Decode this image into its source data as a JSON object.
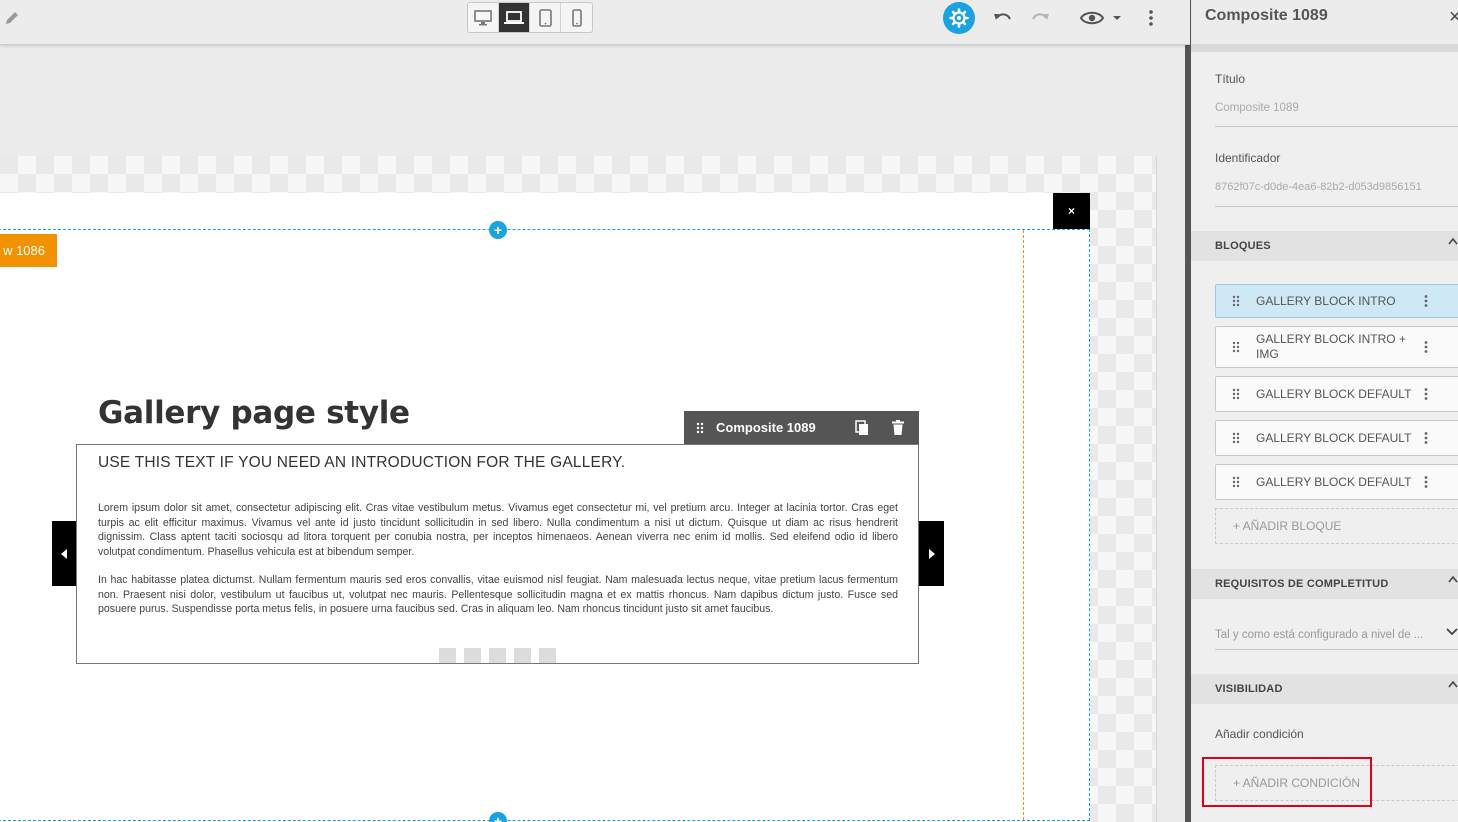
{
  "toolbar": {
    "devices": [
      "desktop-icon",
      "laptop-icon",
      "tablet-icon",
      "mobile-icon"
    ],
    "active_device": "laptop-icon",
    "accent_color": "#1aa3e0"
  },
  "canvas": {
    "close_label": "×",
    "row_label": "w 1086",
    "plus": "+",
    "gallery_title": "Gallery page style",
    "composite_label": "Composite 1089",
    "intro_text": "USE THIS TEXT IF YOU NEED AN INTRODUCTION FOR THE GALLERY.",
    "paragraph_1": "Lorem ipsum dolor sit amet, consectetur adipiscing elit. Cras vitae vestibulum metus. Vivamus eget consectetur mi, vel pretium arcu. Integer at lacinia tortor. Cras eget turpis ac elit efficitur maximus. Vivamus vel ante id justo tincidunt sollicitudin in sed libero. Nulla condimentum a nisi ut dictum. Quisque ut diam ac risus hendrerit dignissim. Class aptent taciti sociosqu ad litora torquent per conubia nostra, per inceptos himenaeos. Aenean viverra nec enim id mollis. Sed eleifend odio id libero volutpat condimentum. Phasellus vehicula est at bibendum semper.",
    "paragraph_2": "In hac habitasse platea dictumst. Nullam fermentum mauris sed eros convallis, vitae euismod nisl feugiat. Nam malesuada lectus neque, vitae pretium lacus fermentum non. Praesent nisi dolor, vestibulum ut faucibus ut, volutpat nec mauris. Pellentesque sollicitudin magna et ex mattis rhoncus. Nam dapibus dictum justo. Fusce sed posuere purus. Suspendisse porta metus felis, in posuere urna faucibus sed. Cras in aliquam leo. Nam rhoncus tincidunt justo sit amet faucibus.",
    "pagination_dots": 5
  },
  "panel": {
    "title": "Composite 1089",
    "close": "×",
    "titulo_label": "Título",
    "titulo_value": "Composite 1089",
    "id_label": "Identificador",
    "id_value": "8762f07c-d0de-4ea6-82b2-d053d9856151",
    "bloques_header": "BLOQUES",
    "blocks": [
      {
        "label": "GALLERY BLOCK INTRO"
      },
      {
        "label": "GALLERY BLOCK INTRO + IMG"
      },
      {
        "label": "GALLERY BLOCK DEFAULT"
      },
      {
        "label": "GALLERY BLOCK DEFAULT"
      },
      {
        "label": "GALLERY BLOCK DEFAULT"
      }
    ],
    "add_block": "+ AÑADIR BLOQUE",
    "requisitos_header": "REQUISITOS DE COMPLETITUD",
    "requisitos_value": "Tal y como está configurado a nivel de ...",
    "visibilidad_header": "VISIBILIDAD",
    "add_condition_label": "Añadir condición",
    "add_condition_button": "+ AÑADIR CONDICIÓN",
    "highlight_color": "#e0001b"
  }
}
